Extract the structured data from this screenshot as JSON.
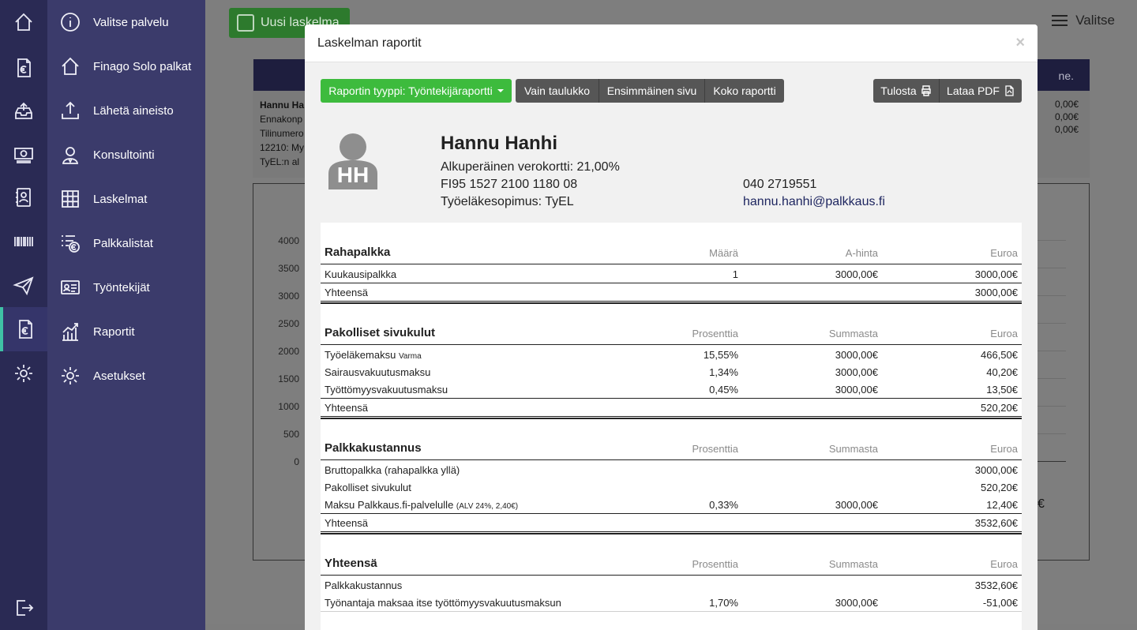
{
  "sidebar": {
    "items": [
      {
        "label": "Valitse palvelu",
        "icon": "info-icon"
      },
      {
        "label": "Finago Solo palkat",
        "icon": "home-icon"
      },
      {
        "label": "Lähetä aineisto",
        "icon": "upload-icon"
      },
      {
        "label": "Konsultointi",
        "icon": "consultant-icon"
      },
      {
        "label": "Laskelmat",
        "icon": "grid-icon"
      },
      {
        "label": "Palkkalistat",
        "icon": "list-icon"
      },
      {
        "label": "Työntekijät",
        "icon": "id-card-icon"
      },
      {
        "label": "Raportit",
        "icon": "chart-icon"
      },
      {
        "label": "Asetukset",
        "icon": "gear-icon"
      }
    ],
    "active_index": 7
  },
  "background": {
    "new_calc_label": "Uusi laskelma",
    "valitse_label": "Valitse",
    "card_partial": [
      "Hannu Ha",
      "Ennakonp",
      "Tilinumero",
      "12210: My",
      "TyEL:n al"
    ],
    "card_head_partial": "ne.",
    "card_values": [
      "0,00€",
      "0,00€",
      "0,00€"
    ],
    "chart_ticks": [
      "4000",
      "3500",
      "3000",
      "2500",
      "2000",
      "1500",
      "1000",
      "500",
      "0"
    ],
    "euro_partial": "€"
  },
  "modal": {
    "title": "Laskelman raportit",
    "close": "×",
    "toolbar": {
      "report_type": "Raportin tyyppi: Työntekijäraportti",
      "only_table": "Vain taulukko",
      "first_page": "Ensimmäinen sivu",
      "full_report": "Koko raportti",
      "print": "Tulosta",
      "download_pdf": "Lataa PDF"
    },
    "employee": {
      "initials": "HH",
      "name": "Hannu Hanhi",
      "tax_card": "Alkuperäinen verokortti: 21,00%",
      "iban": "FI95 1527 2100 1180 08",
      "pension": "Työeläkesopimus: TyEL",
      "phone": "040 2719551",
      "email": "hannu.hanhi@palkkaus.fi"
    },
    "sections": {
      "rahapalkka": {
        "title": "Rahapalkka",
        "headers": [
          "Määrä",
          "A-hinta",
          "Euroa"
        ],
        "rows": [
          {
            "label": "Kuukausipalkka",
            "c2": "1",
            "c3": "3000,00€",
            "c4": "3000,00€"
          }
        ],
        "total": {
          "label": "Yhteensä",
          "value": "3000,00€"
        }
      },
      "sivukulut": {
        "title": "Pakolliset sivukulut",
        "headers": [
          "Prosenttia",
          "Summasta",
          "Euroa"
        ],
        "rows": [
          {
            "label": "Työeläkemaksu",
            "note": "Varma",
            "c2": "15,55%",
            "c3": "3000,00€",
            "c4": "466,50€"
          },
          {
            "label": "Sairausvakuutusmaksu",
            "c2": "1,34%",
            "c3": "3000,00€",
            "c4": "40,20€"
          },
          {
            "label": "Työttömyysvakuutusmaksu",
            "c2": "0,45%",
            "c3": "3000,00€",
            "c4": "13,50€"
          }
        ],
        "total": {
          "label": "Yhteensä",
          "value": "520,20€"
        }
      },
      "kustannus": {
        "title": "Palkkakustannus",
        "headers": [
          "Prosenttia",
          "Summasta",
          "Euroa"
        ],
        "rows": [
          {
            "label": "Bruttopalkka (rahapalkka yllä)",
            "c4": "3000,00€"
          },
          {
            "label": "Pakolliset sivukulut",
            "c4": "520,20€"
          },
          {
            "label": "Maksu Palkkaus.fi-palvelulle",
            "note": "(ALV 24%, 2,40€)",
            "c2": "0,33%",
            "c3": "3000,00€",
            "c4": "12,40€"
          }
        ],
        "total": {
          "label": "Yhteensä",
          "value": "3532,60€"
        }
      },
      "yhteensa": {
        "title": "Yhteensä",
        "headers": [
          "Prosenttia",
          "Summasta",
          "Euroa"
        ],
        "rows": [
          {
            "label": "Palkkakustannus",
            "c4": "3532,60€"
          },
          {
            "label": "Työnantaja maksaa itse työttömyysvakuutusmaksun",
            "c2": "1,70%",
            "c3": "3000,00€",
            "c4": "-51,00€"
          }
        ]
      }
    }
  },
  "colors": {
    "rail": "#2a2a54",
    "menu": "#3b3b6b",
    "accent_teal": "#3fc1a5",
    "green_button": "#3dbb3d",
    "dark_button": "#565656"
  }
}
